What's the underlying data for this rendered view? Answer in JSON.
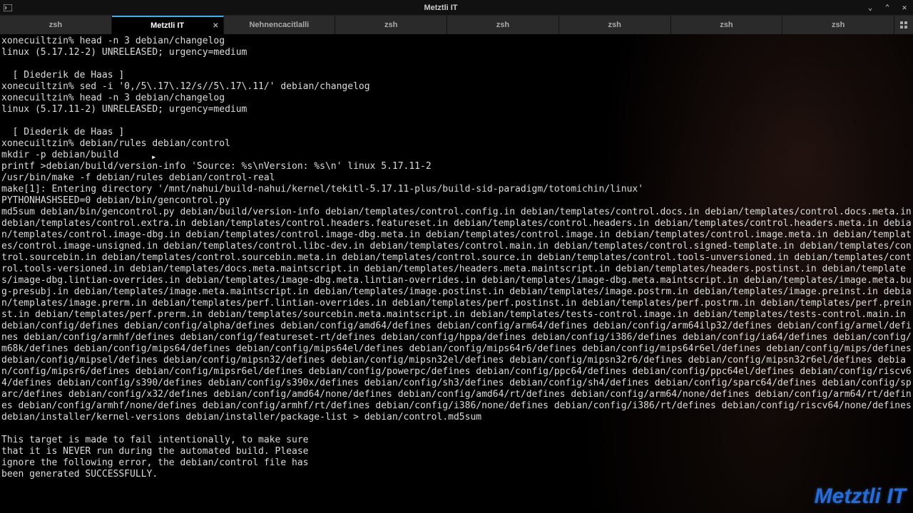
{
  "window": {
    "title": "Metztli IT"
  },
  "tabs": [
    {
      "label": "zsh",
      "active": false
    },
    {
      "label": "Metztli IT",
      "active": true,
      "closable": true
    },
    {
      "label": "Nehnencacitlalli",
      "active": false
    },
    {
      "label": "zsh",
      "active": false
    },
    {
      "label": "zsh",
      "active": false
    },
    {
      "label": "zsh",
      "active": false
    },
    {
      "label": "zsh",
      "active": false
    },
    {
      "label": "zsh",
      "active": false
    }
  ],
  "terminal": {
    "lines": "xonecuiltzin% head -n 3 debian/changelog\nlinux (5.17.12-2) UNRELEASED; urgency=medium\n\n  [ Diederik de Haas ]\nxonecuiltzin% sed -i '0,/5\\.17\\.12/s//5\\.17\\.11/' debian/changelog\nxonecuiltzin% head -n 3 debian/changelog\nlinux (5.17.11-2) UNRELEASED; urgency=medium\n\n  [ Diederik de Haas ]\nxonecuiltzin% debian/rules debian/control\nmkdir -p debian/build\nprintf >debian/build/version-info 'Source: %s\\nVersion: %s\\n' linux 5.17.11-2\n/usr/bin/make -f debian/rules debian/control-real\nmake[1]: Entering directory '/mnt/nahui/build-nahui/kernel/tekitl-5.17.11-plus/build-sid-paradigm/totomichin/linux'\nPYTHONHASHSEED=0 debian/bin/gencontrol.py\nmd5sum debian/bin/gencontrol.py debian/build/version-info debian/templates/control.config.in debian/templates/control.docs.in debian/templates/control.docs.meta.in debian/templates/control.extra.in debian/templates/control.headers.featureset.in debian/templates/control.headers.in debian/templates/control.headers.meta.in debian/templates/control.image-dbg.in debian/templates/control.image-dbg.meta.in debian/templates/control.image.in debian/templates/control.image.meta.in debian/templates/control.image-unsigned.in debian/templates/control.libc-dev.in debian/templates/control.main.in debian/templates/control.signed-template.in debian/templates/control.sourcebin.in debian/templates/control.sourcebin.meta.in debian/templates/control.source.in debian/templates/control.tools-unversioned.in debian/templates/control.tools-versioned.in debian/templates/docs.meta.maintscript.in debian/templates/headers.meta.maintscript.in debian/templates/headers.postinst.in debian/templates/image-dbg.lintian-overrides.in debian/templates/image-dbg.meta.lintian-overrides.in debian/templates/image-dbg.meta.maintscript.in debian/templates/image.meta.bug-presubj.in debian/templates/image.meta.maintscript.in debian/templates/image.postinst.in debian/templates/image.postrm.in debian/templates/image.preinst.in debian/templates/image.prerm.in debian/templates/perf.lintian-overrides.in debian/templates/perf.postinst.in debian/templates/perf.postrm.in debian/templates/perf.preinst.in debian/templates/perf.prerm.in debian/templates/sourcebin.meta.maintscript.in debian/templates/tests-control.image.in debian/templates/tests-control.main.in debian/config/defines debian/config/alpha/defines debian/config/amd64/defines debian/config/arm64/defines debian/config/arm64ilp32/defines debian/config/armel/defines debian/config/armhf/defines debian/config/featureset-rt/defines debian/config/hppa/defines debian/config/i386/defines debian/config/ia64/defines debian/config/m68k/defines debian/config/mips64/defines debian/config/mips64el/defines debian/config/mips64r6/defines debian/config/mips64r6el/defines debian/config/mips/defines debian/config/mipsel/defines debian/config/mipsn32/defines debian/config/mipsn32el/defines debian/config/mipsn32r6/defines debian/config/mipsn32r6el/defines debian/config/mipsr6/defines debian/config/mipsr6el/defines debian/config/powerpc/defines debian/config/ppc64/defines debian/config/ppc64el/defines debian/config/riscv64/defines debian/config/s390/defines debian/config/s390x/defines debian/config/sh3/defines debian/config/sh4/defines debian/config/sparc64/defines debian/config/sparc/defines debian/config/x32/defines debian/config/amd64/none/defines debian/config/amd64/rt/defines debian/config/arm64/none/defines debian/config/arm64/rt/defines debian/config/armhf/none/defines debian/config/armhf/rt/defines debian/config/i386/none/defines debian/config/i386/rt/defines debian/config/riscv64/none/defines debian/installer/kernel-versions debian/installer/package-list > debian/control.md5sum\n\nThis target is made to fail intentionally, to make sure\nthat it is NEVER run during the automated build. Please\nignore the following error, the debian/control file has\nbeen generated SUCCESSFULLY."
  },
  "watermark": "Metztli IT"
}
